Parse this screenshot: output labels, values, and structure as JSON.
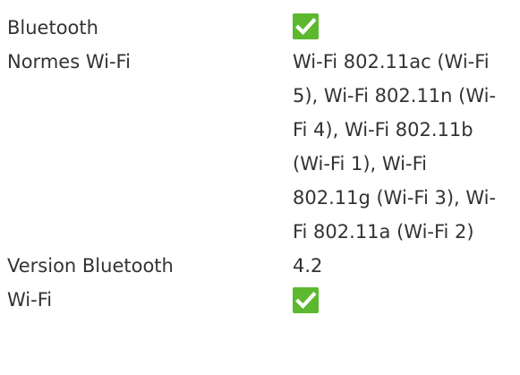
{
  "colors": {
    "text": "#333333",
    "check_green": "#5cb82e",
    "check_mark": "#ffffff"
  },
  "specs": [
    {
      "label": "Bluetooth",
      "value": null,
      "icon": "check-icon"
    },
    {
      "label": "Normes Wi-Fi",
      "value": "Wi-Fi 802.11ac (Wi-Fi 5), Wi-Fi 802.11n (Wi-Fi 4), Wi-Fi 802.11b (Wi-Fi 1), Wi-Fi 802.11g (Wi-Fi 3), Wi-Fi 802.11a (Wi-Fi 2)"
    },
    {
      "label": "Version Bluetooth",
      "value": "4.2"
    },
    {
      "label": "Wi-Fi",
      "value": null,
      "icon": "check-icon"
    }
  ]
}
